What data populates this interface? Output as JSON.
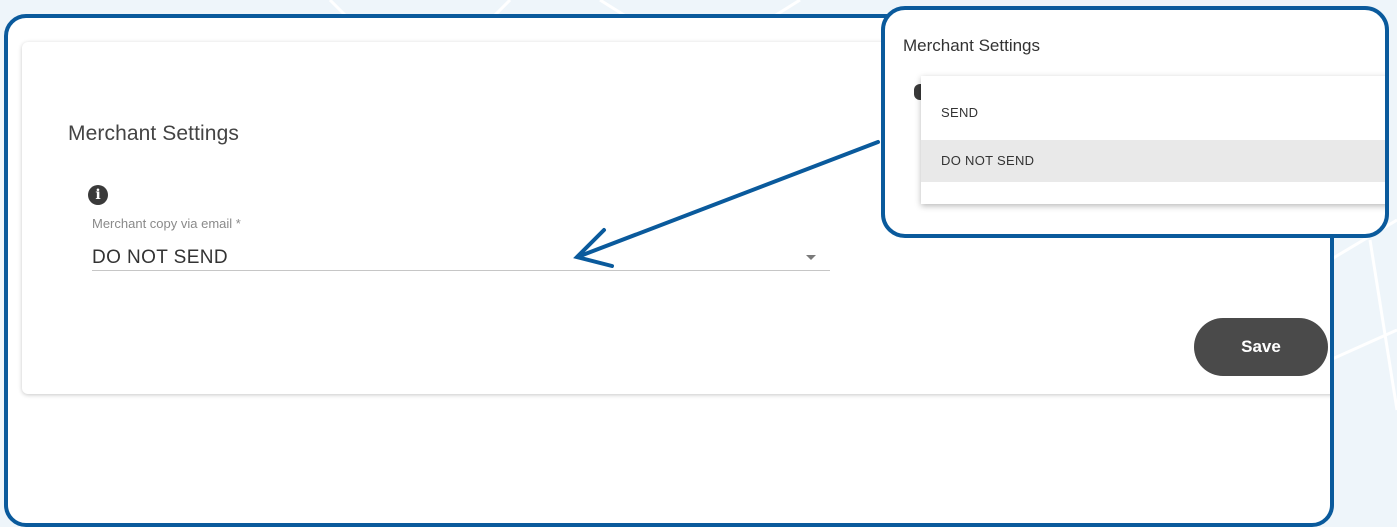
{
  "section": {
    "title": "Merchant Settings",
    "info_icon": "info-icon"
  },
  "field": {
    "label": "Merchant copy via email *",
    "value": "DO NOT SEND",
    "caret_icon": "caret-down-icon"
  },
  "save_button": {
    "label": "Save"
  },
  "zoom_callout": {
    "title": "Merchant Settings",
    "options": [
      "SEND",
      "DO NOT SEND"
    ],
    "selected": "DO NOT SEND"
  },
  "colors": {
    "frame_border": "#0a5a9c",
    "button_bg": "#4a4a4a",
    "selected_option_bg": "#e9e9e9"
  }
}
